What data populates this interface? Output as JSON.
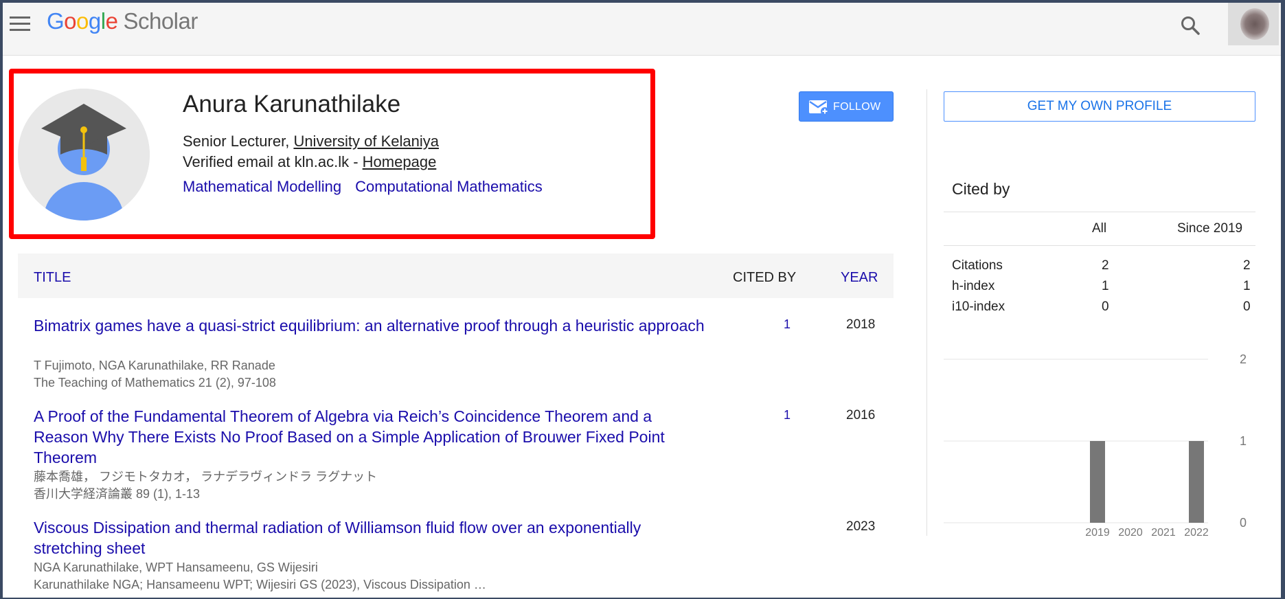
{
  "header": {
    "logo": {
      "g1": "G",
      "g2": "o",
      "g3": "o",
      "g4": "g",
      "g5": "l",
      "g6": "e",
      "scholar": "Scholar"
    },
    "icons": {
      "menu": "menu-icon",
      "search": "search-icon",
      "avatar": "account-avatar"
    }
  },
  "profile": {
    "name": "Anura Karunathilake",
    "affiliation_prefix": "Senior Lecturer, ",
    "affiliation_link": "University of Kelaniya",
    "email_text": "Verified email at kln.ac.lk - ",
    "homepage": "Homepage",
    "interests": [
      "Mathematical Modelling",
      "Computational Mathematics"
    ],
    "follow_label": "FOLLOW"
  },
  "table": {
    "headers": {
      "title": "TITLE",
      "cited_by": "CITED BY",
      "year": "YEAR"
    },
    "rows": [
      {
        "title": "Bimatrix games have a quasi-strict equilibrium: an alternative proof through a heuristic approach",
        "authors": "T Fujimoto, NGA Karunathilake, RR Ranade",
        "venue": "The Teaching of Mathematics 21 (2), 97-108",
        "cited": "1",
        "year": "2018"
      },
      {
        "title": "A Proof of the Fundamental Theorem of Algebra via Reich’s Coincidence Theorem and a Reason Why There Exists No Proof Based on a Simple Application of Brouwer Fixed Point Theorem",
        "authors": "藤本喬雄， フジモトタカオ， ラナデラヴィンドラ ラグナット",
        "venue": "香川大学経済論叢 89 (1), 1-13",
        "cited": "1",
        "year": "2016"
      },
      {
        "title": "Viscous Dissipation and thermal radiation of Williamson fluid flow over an exponentially stretching sheet",
        "authors": "NGA Karunathilake, WPT Hansameenu, GS Wijesiri",
        "venue": "Karunathilake NGA; Hansameenu WPT; Wijesiri GS (2023), Viscous Dissipation …",
        "cited": "",
        "year": "2023"
      }
    ]
  },
  "sidebar": {
    "get_profile": "GET MY OWN PROFILE",
    "cited_by_title": "Cited by",
    "columns": {
      "all": "All",
      "since": "Since 2019"
    },
    "stats": [
      {
        "label": "Citations",
        "all": "2",
        "since": "2"
      },
      {
        "label": "h-index",
        "all": "1",
        "since": "1"
      },
      {
        "label": "i10-index",
        "all": "0",
        "since": "0"
      }
    ]
  },
  "chart_data": {
    "type": "bar",
    "categories": [
      "2019",
      "2020",
      "2021",
      "2022"
    ],
    "values": [
      1,
      0,
      0,
      1
    ],
    "yticks": [
      "0",
      "1",
      "2"
    ],
    "ylim": [
      0,
      2
    ],
    "bar_color": "#777777"
  }
}
